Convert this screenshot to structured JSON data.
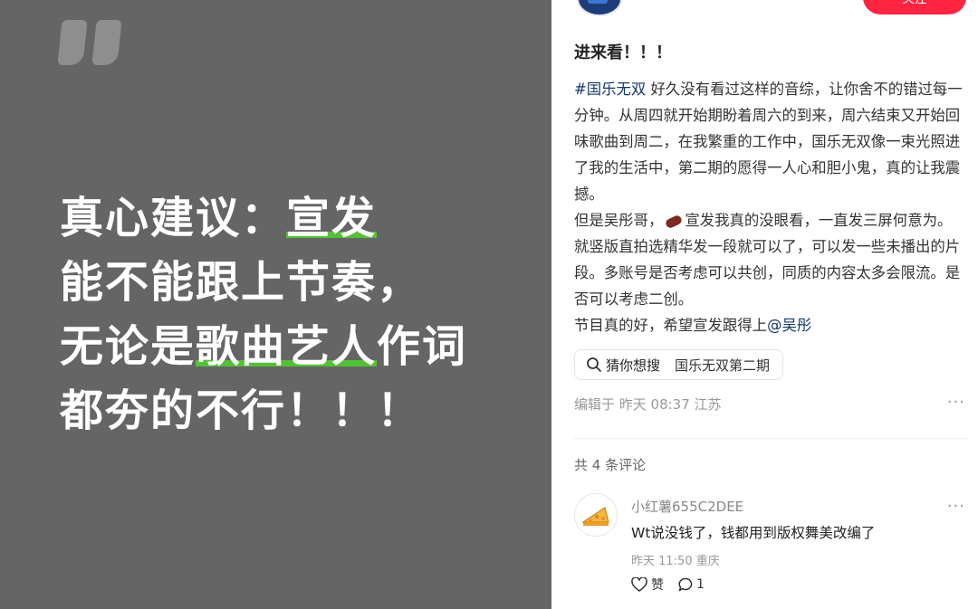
{
  "image_card": {
    "line1": "真心建议：",
    "line1_hl": "宣发",
    "line2": "能不能跟上节奏，",
    "line3_a": "无论是",
    "line3_hl": "歌曲艺人",
    "line3_b": "作词",
    "line4": "都夯的不行！！！",
    "quote_icon": "quote-mark-icon",
    "highlight_color": "#53c135"
  },
  "header": {
    "follow_label": "关注",
    "accent": "#ff2442"
  },
  "post": {
    "title": "进来看！！！",
    "tag": "#国乐无双",
    "p1": " 好久没有看过这样的音综，让你舍不的错过每一分钟。从周四就开始期盼着周六的到来，周六结束又开始回味歌曲到周二，在我繁重的工作中，国乐无双像一束光照进了我的生活中，第二期的愿得一人心和胆小鬼，真的让我震撼。",
    "p2a": "但是吴彤哥，",
    "p2b": "宣发我真的没眼看，一直发三屏何意为。就竖版直拍选精华发一段就可以了，可以发一些未播出的片段。多账号是否考虑可以共创，同质的内容太多会限流。是否可以考虑二创。",
    "p3": "节目真的好，希望宣发跟得上",
    "mention": "@吴彤",
    "search_label": "猜你想搜",
    "search_query": "国乐无双第二期",
    "meta": "编辑于 昨天 08:37 江苏",
    "more": "···"
  },
  "comments": {
    "count_text": "共 4 条评论",
    "items": [
      {
        "user": "小红薯655C2DEE",
        "text": "Wt说没钱了，钱都用到版权舞美改编了",
        "meta": "昨天 11:50 重庆",
        "like_label": "赞",
        "reply_count": "1",
        "more": "···"
      }
    ]
  }
}
